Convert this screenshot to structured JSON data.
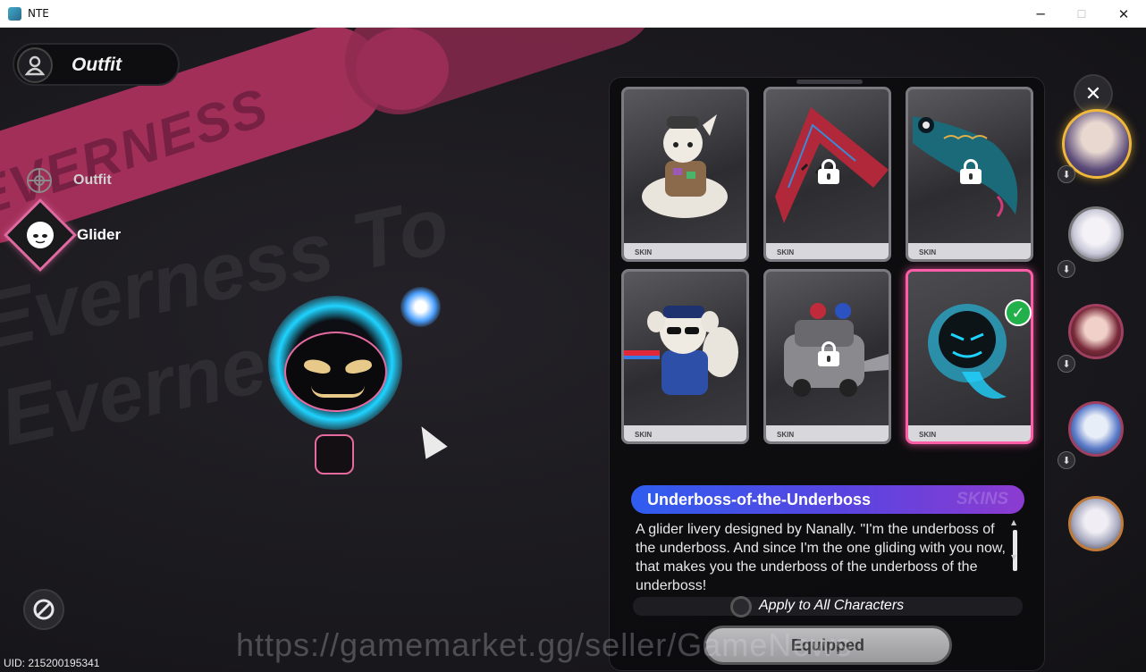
{
  "window": {
    "title": "NTE",
    "minimize": "─",
    "maximize": "☐",
    "close": "✕"
  },
  "left_menu": {
    "section_title": "Outfit",
    "items": [
      {
        "label": "Outfit"
      },
      {
        "label": "Glider"
      }
    ],
    "uid": "UID: 215200195341"
  },
  "background": {
    "banner_text": "EVERNESS"
  },
  "skins": {
    "cards": [
      {
        "name": "card-1",
        "locked": false,
        "tag": "SKIN",
        "equipped": false
      },
      {
        "name": "card-2",
        "locked": true,
        "tag": "SKIN",
        "equipped": false
      },
      {
        "name": "card-3",
        "locked": true,
        "tag": "SKIN",
        "equipped": false
      },
      {
        "name": "card-4",
        "locked": false,
        "tag": "SKIN",
        "equipped": false
      },
      {
        "name": "card-5",
        "locked": true,
        "tag": "SKIN",
        "equipped": false
      },
      {
        "name": "card-6",
        "locked": false,
        "tag": "SKIN",
        "equipped": true
      }
    ],
    "selected_title": "Underboss-of-the-Underboss",
    "title_badge": "SKINS",
    "description": "A glider livery designed by Nanally. \"I'm the underboss of the underboss. And since I'm the one gliding with you now, that makes you the underboss of the underboss of the underboss!",
    "apply_all_label": "Apply to All Characters",
    "equip_button": "Equipped"
  },
  "right_rail": {
    "close_label": "✕",
    "characters": [
      {
        "name": "character-1",
        "active": true,
        "download": true
      },
      {
        "name": "character-2",
        "active": false,
        "download": true
      },
      {
        "name": "character-3",
        "active": false,
        "download": true
      },
      {
        "name": "character-4",
        "active": false,
        "download": true
      },
      {
        "name": "character-5",
        "active": false,
        "download": false
      }
    ]
  },
  "watermark": "https://gamemarket.gg/seller/GameNews",
  "colors": {
    "accent_pink": "#ff5da8",
    "title_gradient_start": "#2f5df0",
    "title_gradient_end": "#8c3bd0",
    "equipped_check": "#22b04a",
    "active_avatar_ring": "#f0b83a"
  }
}
